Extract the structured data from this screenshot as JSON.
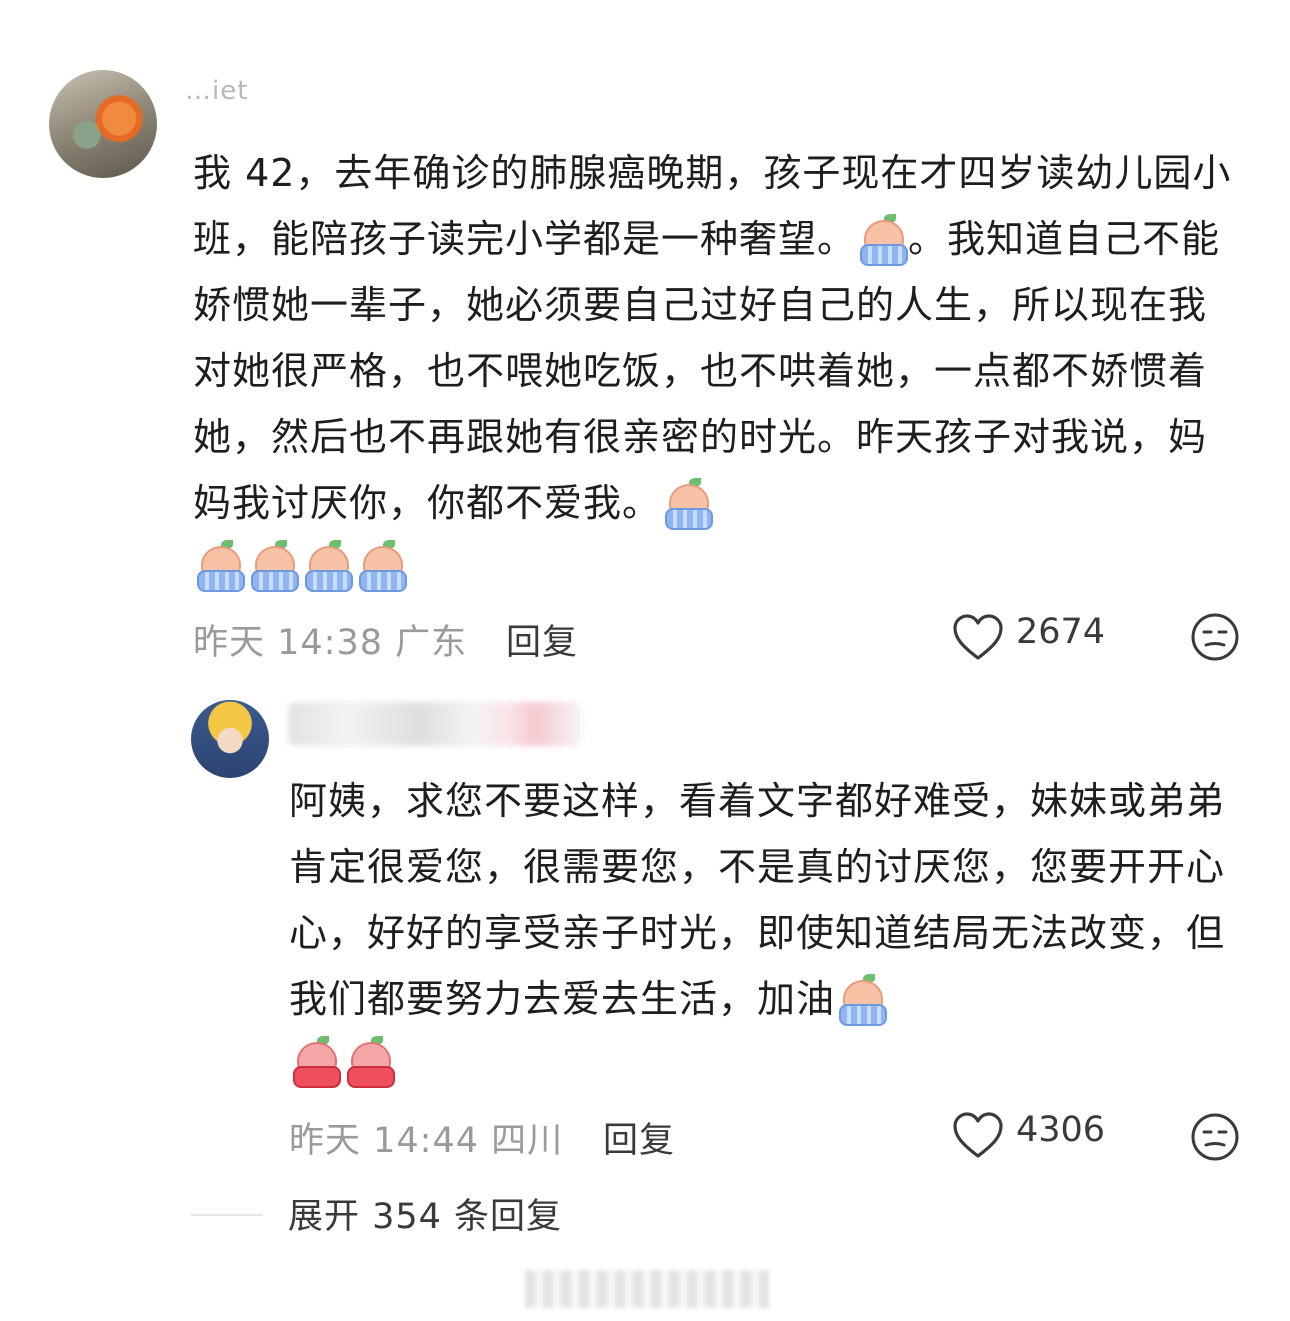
{
  "comment": {
    "username": "…iet",
    "text": "我 42，去年确诊的肺腺癌晚期，孩子现在才四岁读幼儿园小班，能陪孩子读完小学都是一种奢望。",
    "text2": "。我知道自己不能娇惯她一辈子，她必须要自己过好自己的人生，所以现在我对她很严格，也不喂她吃饭，也不哄着她，一点都不娇惯着她，然后也不再跟她有很亲密的时光。昨天孩子对我说，妈妈我讨厌你，你都不爱我。",
    "time": "昨天 14:38 广东",
    "reply_label": "回复",
    "likes": "2674",
    "emoji_name": "crying-emoji"
  },
  "reply": {
    "text": "阿姨，求您不要这样，看着文字都好难受，妹妹或弟弟肯定很爱您，很需要您，不是真的讨厌您，您要开开心心，好好的享受亲子时光，即使知道结局无法改变，但我们都要努力去爱去生活，加油",
    "time": "昨天 14:44 四川",
    "reply_label": "回复",
    "likes": "4306",
    "emoji_name": "cheer-emoji"
  },
  "expand": {
    "label": "展开 354 条回复"
  },
  "colors": {
    "text": "#1e1e1e",
    "meta": "#9a9a9a",
    "action": "#3a3a3a"
  }
}
